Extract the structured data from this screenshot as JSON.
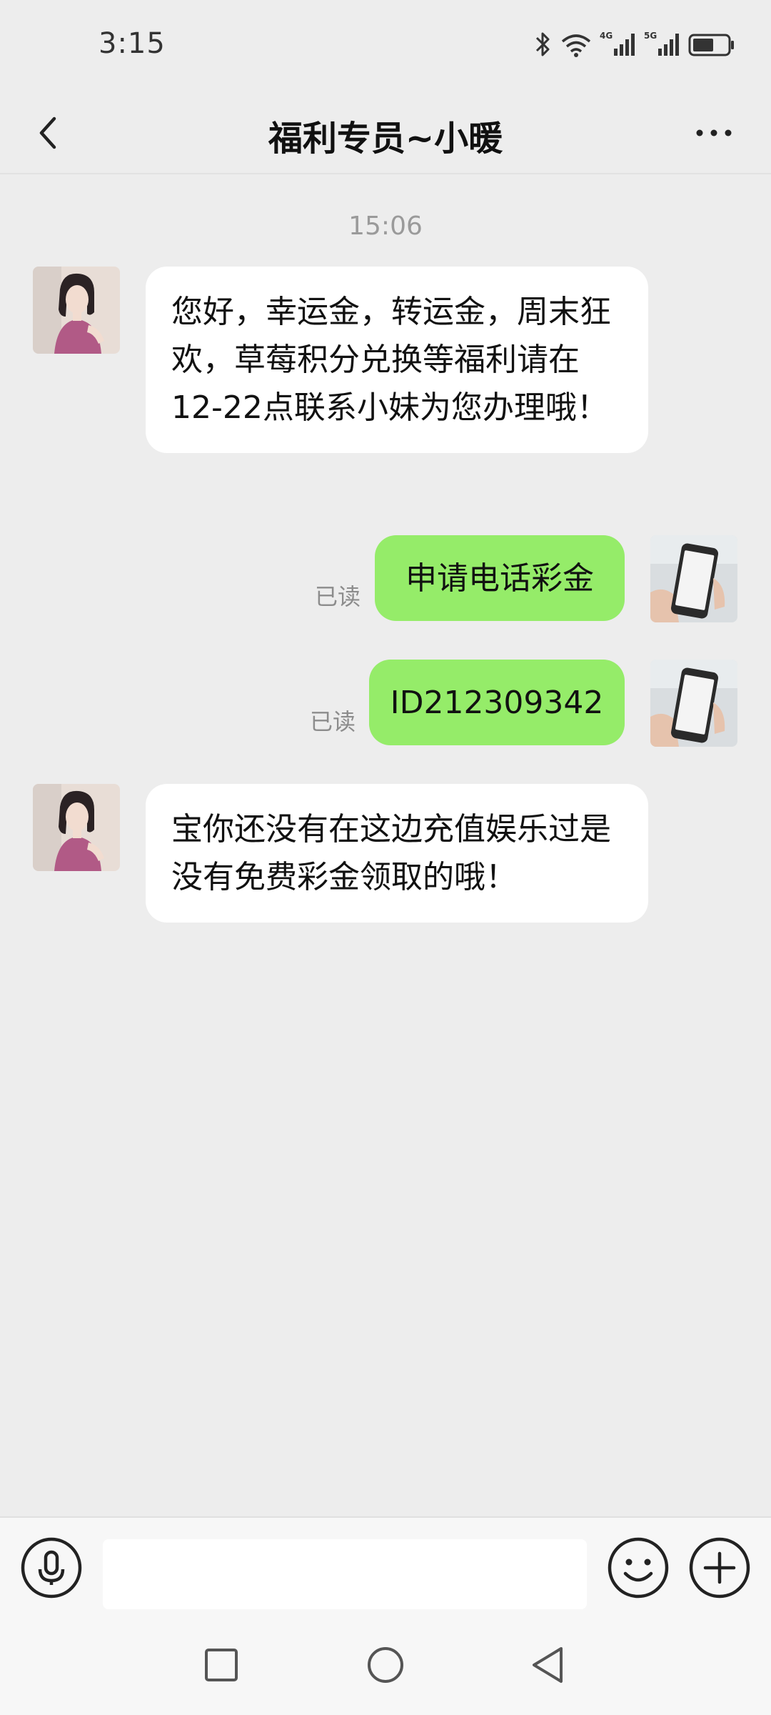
{
  "status_bar": {
    "time": "3:15",
    "icons": [
      "bluetooth-icon",
      "wifi-icon",
      "signal-4g-icon",
      "signal-5g-icon",
      "battery-icon"
    ]
  },
  "nav": {
    "title": "福利专员~小暖",
    "back_icon": "chevron-left-icon",
    "more_icon": "more-horizontal-icon"
  },
  "chat": {
    "timestamp": "15:06",
    "messages": [
      {
        "direction": "incoming",
        "text": "您好，幸运金，转运金，周末狂欢，草莓积分兑换等福利请在12-22点联系小妹为您办理哦！"
      },
      {
        "direction": "outgoing",
        "text": "申请电话彩金",
        "status": "已读"
      },
      {
        "direction": "outgoing",
        "text": "ID212309342",
        "status": "已读"
      },
      {
        "direction": "incoming",
        "text": "宝你还没有在这边充值娱乐过是没有免费彩金领取的哦！"
      }
    ]
  },
  "input_bar": {
    "text_value": "",
    "voice_icon": "microphone-icon",
    "emoji_icon": "emoji-smile-icon",
    "plus_icon": "plus-circle-icon"
  },
  "system_nav": {
    "icons": [
      "recent-apps-square-icon",
      "home-circle-icon",
      "back-triangle-icon"
    ]
  },
  "colors": {
    "background": "#ededed",
    "incoming_bubble": "#ffffff",
    "outgoing_bubble": "#95ec69",
    "read_status": "#8c8c8c"
  }
}
